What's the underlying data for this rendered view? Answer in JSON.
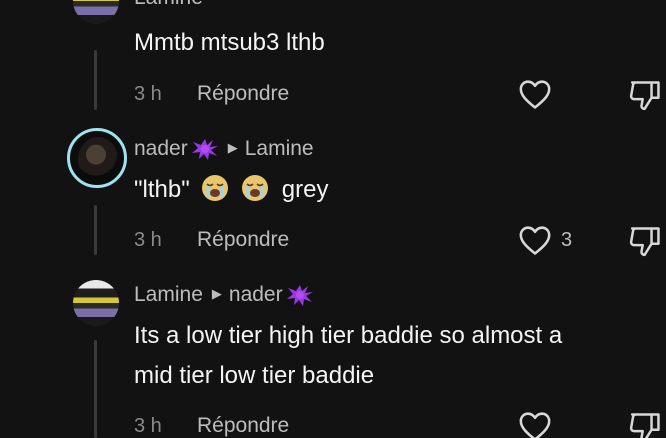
{
  "colors": {
    "background": "#121212",
    "primary_text": "#f4f4f4",
    "secondary_text": "#bdbdbd",
    "time_text": "#8a8a8a",
    "avatar_ring": "#9fe2f0",
    "splat_emoji": "#9b38e6"
  },
  "comments": [
    {
      "username": "Lamine",
      "text": "Mmtb mtsub3 lthb",
      "time": "3 h",
      "reply_label": "Répondre",
      "likes": ""
    },
    {
      "username": "nader",
      "reply_to": "Lamine",
      "text_prefix": "\"lthb\"",
      "emojis": [
        "loudly-crying-face",
        "loudly-crying-face"
      ],
      "text_suffix": "grey",
      "time": "3 h",
      "reply_label": "Répondre",
      "likes": "3"
    },
    {
      "username": "Lamine",
      "reply_to": "nader",
      "text_line1": "Its a low tier high tier baddie so almost a",
      "text_line2": "mid tier low tier baddie",
      "time": "3 h",
      "reply_label": "Répondre",
      "likes": ""
    }
  ],
  "icons": {
    "like": "heart-outline-icon",
    "dislike": "thumbs-down-outline-icon",
    "reply_arrow": "right-triangle-icon",
    "name_emoji": "purple-splat-emoji"
  }
}
